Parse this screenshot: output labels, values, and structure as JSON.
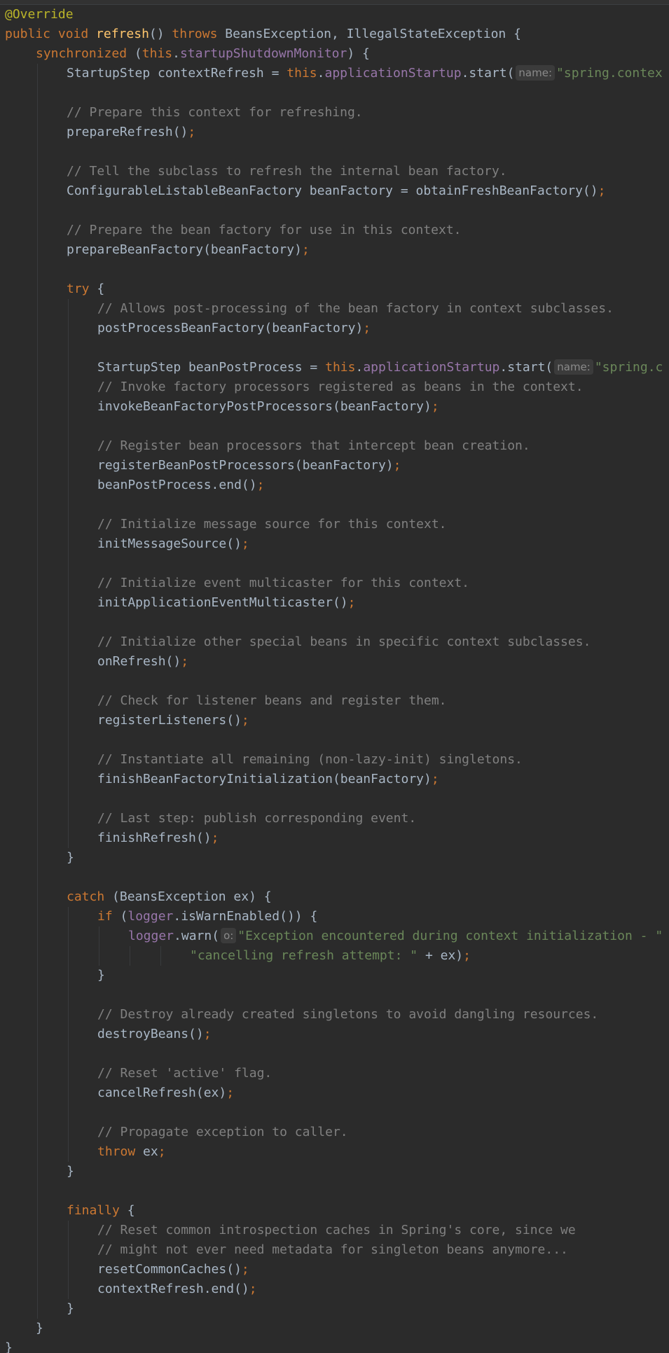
{
  "editor": {
    "language": "Java",
    "colors": {
      "background": "#2b2b2b",
      "keyword": "#cc7832",
      "annotation": "#bbb529",
      "field": "#9876aa",
      "string": "#6a8759",
      "comment": "#808080",
      "method_declaration": "#ffc66d",
      "plain": "#a9b7c6",
      "inlay_hint": "#8a8a8a"
    },
    "lines": [
      {
        "indent": 0,
        "tokens": [
          {
            "t": "ann",
            "v": "@Override"
          }
        ]
      },
      {
        "indent": 0,
        "tokens": [
          {
            "t": "kw",
            "v": "public void "
          },
          {
            "t": "fn",
            "v": "refresh"
          },
          {
            "t": "plain",
            "v": "() "
          },
          {
            "t": "kw",
            "v": "throws "
          },
          {
            "t": "plain",
            "v": "BeansException, IllegalStateException {"
          }
        ]
      },
      {
        "indent": 1,
        "tokens": [
          {
            "t": "kw",
            "v": "synchronized "
          },
          {
            "t": "plain",
            "v": "("
          },
          {
            "t": "kw",
            "v": "this"
          },
          {
            "t": "plain",
            "v": "."
          },
          {
            "t": "fld",
            "v": "startupShutdownMonitor"
          },
          {
            "t": "plain",
            "v": ") {"
          }
        ]
      },
      {
        "indent": 2,
        "tokens": [
          {
            "t": "plain",
            "v": "StartupStep contextRefresh = "
          },
          {
            "t": "kw",
            "v": "this"
          },
          {
            "t": "plain",
            "v": "."
          },
          {
            "t": "fld",
            "v": "applicationStartup"
          },
          {
            "t": "plain",
            "v": ".start("
          },
          {
            "t": "hint",
            "v": "name:"
          },
          {
            "t": "str",
            "v": "\"spring.contex"
          }
        ]
      },
      {
        "indent": 0,
        "tokens": []
      },
      {
        "indent": 2,
        "tokens": [
          {
            "t": "cmt",
            "v": "// Prepare this context for refreshing."
          }
        ]
      },
      {
        "indent": 2,
        "tokens": [
          {
            "t": "plain",
            "v": "prepareRefresh()"
          },
          {
            "t": "kw",
            "v": ";"
          }
        ]
      },
      {
        "indent": 0,
        "tokens": []
      },
      {
        "indent": 2,
        "tokens": [
          {
            "t": "cmt",
            "v": "// Tell the subclass to refresh the internal bean factory."
          }
        ]
      },
      {
        "indent": 2,
        "tokens": [
          {
            "t": "plain",
            "v": "ConfigurableListableBeanFactory beanFactory = obtainFreshBeanFactory()"
          },
          {
            "t": "kw",
            "v": ";"
          }
        ]
      },
      {
        "indent": 0,
        "tokens": []
      },
      {
        "indent": 2,
        "tokens": [
          {
            "t": "cmt",
            "v": "// Prepare the bean factory for use in this context."
          }
        ]
      },
      {
        "indent": 2,
        "tokens": [
          {
            "t": "plain",
            "v": "prepareBeanFactory(beanFactory)"
          },
          {
            "t": "kw",
            "v": ";"
          }
        ]
      },
      {
        "indent": 0,
        "tokens": []
      },
      {
        "indent": 2,
        "tokens": [
          {
            "t": "kw",
            "v": "try "
          },
          {
            "t": "plain",
            "v": "{"
          }
        ]
      },
      {
        "indent": 3,
        "tokens": [
          {
            "t": "cmt",
            "v": "// Allows post-processing of the bean factory in context subclasses."
          }
        ]
      },
      {
        "indent": 3,
        "tokens": [
          {
            "t": "plain",
            "v": "postProcessBeanFactory(beanFactory)"
          },
          {
            "t": "kw",
            "v": ";"
          }
        ]
      },
      {
        "indent": 0,
        "tokens": []
      },
      {
        "indent": 3,
        "tokens": [
          {
            "t": "plain",
            "v": "StartupStep beanPostProcess = "
          },
          {
            "t": "kw",
            "v": "this"
          },
          {
            "t": "plain",
            "v": "."
          },
          {
            "t": "fld",
            "v": "applicationStartup"
          },
          {
            "t": "plain",
            "v": ".start("
          },
          {
            "t": "hint",
            "v": "name:"
          },
          {
            "t": "str",
            "v": "\"spring.c"
          }
        ]
      },
      {
        "indent": 3,
        "tokens": [
          {
            "t": "cmt",
            "v": "// Invoke factory processors registered as beans in the context."
          }
        ]
      },
      {
        "indent": 3,
        "tokens": [
          {
            "t": "plain",
            "v": "invokeBeanFactoryPostProcessors(beanFactory)"
          },
          {
            "t": "kw",
            "v": ";"
          }
        ]
      },
      {
        "indent": 0,
        "tokens": []
      },
      {
        "indent": 3,
        "tokens": [
          {
            "t": "cmt",
            "v": "// Register bean processors that intercept bean creation."
          }
        ]
      },
      {
        "indent": 3,
        "tokens": [
          {
            "t": "plain",
            "v": "registerBeanPostProcessors(beanFactory)"
          },
          {
            "t": "kw",
            "v": ";"
          }
        ]
      },
      {
        "indent": 3,
        "tokens": [
          {
            "t": "plain",
            "v": "beanPostProcess.end()"
          },
          {
            "t": "kw",
            "v": ";"
          }
        ]
      },
      {
        "indent": 0,
        "tokens": []
      },
      {
        "indent": 3,
        "tokens": [
          {
            "t": "cmt",
            "v": "// Initialize message source for this context."
          }
        ]
      },
      {
        "indent": 3,
        "tokens": [
          {
            "t": "plain",
            "v": "initMessageSource()"
          },
          {
            "t": "kw",
            "v": ";"
          }
        ]
      },
      {
        "indent": 0,
        "tokens": []
      },
      {
        "indent": 3,
        "tokens": [
          {
            "t": "cmt",
            "v": "// Initialize event multicaster for this context."
          }
        ]
      },
      {
        "indent": 3,
        "tokens": [
          {
            "t": "plain",
            "v": "initApplicationEventMulticaster()"
          },
          {
            "t": "kw",
            "v": ";"
          }
        ]
      },
      {
        "indent": 0,
        "tokens": []
      },
      {
        "indent": 3,
        "tokens": [
          {
            "t": "cmt",
            "v": "// Initialize other special beans in specific context subclasses."
          }
        ]
      },
      {
        "indent": 3,
        "tokens": [
          {
            "t": "plain",
            "v": "onRefresh()"
          },
          {
            "t": "kw",
            "v": ";"
          }
        ]
      },
      {
        "indent": 0,
        "tokens": []
      },
      {
        "indent": 3,
        "tokens": [
          {
            "t": "cmt",
            "v": "// Check for listener beans and register them."
          }
        ]
      },
      {
        "indent": 3,
        "tokens": [
          {
            "t": "plain",
            "v": "registerListeners()"
          },
          {
            "t": "kw",
            "v": ";"
          }
        ]
      },
      {
        "indent": 0,
        "tokens": []
      },
      {
        "indent": 3,
        "tokens": [
          {
            "t": "cmt",
            "v": "// Instantiate all remaining (non-lazy-init) singletons."
          }
        ]
      },
      {
        "indent": 3,
        "tokens": [
          {
            "t": "plain",
            "v": "finishBeanFactoryInitialization(beanFactory)"
          },
          {
            "t": "kw",
            "v": ";"
          }
        ]
      },
      {
        "indent": 0,
        "tokens": []
      },
      {
        "indent": 3,
        "tokens": [
          {
            "t": "cmt",
            "v": "// Last step: publish corresponding event."
          }
        ]
      },
      {
        "indent": 3,
        "tokens": [
          {
            "t": "plain",
            "v": "finishRefresh()"
          },
          {
            "t": "kw",
            "v": ";"
          }
        ]
      },
      {
        "indent": 2,
        "tokens": [
          {
            "t": "plain",
            "v": "}"
          }
        ]
      },
      {
        "indent": 0,
        "tokens": []
      },
      {
        "indent": 2,
        "tokens": [
          {
            "t": "kw",
            "v": "catch "
          },
          {
            "t": "plain",
            "v": "(BeansException ex) {"
          }
        ]
      },
      {
        "indent": 3,
        "tokens": [
          {
            "t": "kw",
            "v": "if "
          },
          {
            "t": "plain",
            "v": "("
          },
          {
            "t": "fld",
            "v": "logger"
          },
          {
            "t": "plain",
            "v": ".isWarnEnabled()) {"
          }
        ]
      },
      {
        "indent": 4,
        "tokens": [
          {
            "t": "fld",
            "v": "logger"
          },
          {
            "t": "plain",
            "v": ".warn("
          },
          {
            "t": "hint",
            "v": "o:"
          },
          {
            "t": "str",
            "v": "\"Exception encountered during context initialization - \""
          }
        ]
      },
      {
        "indent": 6,
        "tokens": [
          {
            "t": "str",
            "v": "\"cancelling refresh attempt: \" "
          },
          {
            "t": "plain",
            "v": "+ ex)"
          },
          {
            "t": "kw",
            "v": ";"
          }
        ]
      },
      {
        "indent": 3,
        "tokens": [
          {
            "t": "plain",
            "v": "}"
          }
        ]
      },
      {
        "indent": 0,
        "tokens": []
      },
      {
        "indent": 3,
        "tokens": [
          {
            "t": "cmt",
            "v": "// Destroy already created singletons to avoid dangling resources."
          }
        ]
      },
      {
        "indent": 3,
        "tokens": [
          {
            "t": "plain",
            "v": "destroyBeans()"
          },
          {
            "t": "kw",
            "v": ";"
          }
        ]
      },
      {
        "indent": 0,
        "tokens": []
      },
      {
        "indent": 3,
        "tokens": [
          {
            "t": "cmt",
            "v": "// Reset 'active' flag."
          }
        ]
      },
      {
        "indent": 3,
        "tokens": [
          {
            "t": "plain",
            "v": "cancelRefresh(ex)"
          },
          {
            "t": "kw",
            "v": ";"
          }
        ]
      },
      {
        "indent": 0,
        "tokens": []
      },
      {
        "indent": 3,
        "tokens": [
          {
            "t": "cmt",
            "v": "// Propagate exception to caller."
          }
        ]
      },
      {
        "indent": 3,
        "tokens": [
          {
            "t": "kw",
            "v": "throw "
          },
          {
            "t": "plain",
            "v": "ex"
          },
          {
            "t": "kw",
            "v": ";"
          }
        ]
      },
      {
        "indent": 2,
        "tokens": [
          {
            "t": "plain",
            "v": "}"
          }
        ]
      },
      {
        "indent": 0,
        "tokens": []
      },
      {
        "indent": 2,
        "tokens": [
          {
            "t": "kw",
            "v": "finally "
          },
          {
            "t": "plain",
            "v": "{"
          }
        ]
      },
      {
        "indent": 3,
        "tokens": [
          {
            "t": "cmt",
            "v": "// Reset common introspection caches in Spring's core, since we"
          }
        ]
      },
      {
        "indent": 3,
        "tokens": [
          {
            "t": "cmt",
            "v": "// might not ever need metadata for singleton beans anymore..."
          }
        ]
      },
      {
        "indent": 3,
        "tokens": [
          {
            "t": "plain",
            "v": "resetCommonCaches()"
          },
          {
            "t": "kw",
            "v": ";"
          }
        ]
      },
      {
        "indent": 3,
        "tokens": [
          {
            "t": "plain",
            "v": "contextRefresh.end()"
          },
          {
            "t": "kw",
            "v": ";"
          }
        ]
      },
      {
        "indent": 2,
        "tokens": [
          {
            "t": "plain",
            "v": "}"
          }
        ]
      },
      {
        "indent": 1,
        "tokens": [
          {
            "t": "plain",
            "v": "}"
          }
        ]
      },
      {
        "indent": 0,
        "tokens": [
          {
            "t": "plain",
            "v": "}"
          }
        ]
      }
    ]
  }
}
